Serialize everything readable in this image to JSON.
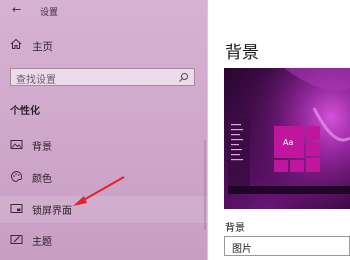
{
  "window": {
    "title": "设置",
    "back_glyph": "←"
  },
  "sidebar": {
    "home_label": "主页",
    "search_placeholder": "查找设置",
    "section_label": "个性化",
    "items": [
      {
        "label": "背景",
        "icon": "picture-icon"
      },
      {
        "label": "颜色",
        "icon": "palette-icon"
      },
      {
        "label": "锁屏界面",
        "icon": "lock-screen-icon"
      },
      {
        "label": "主题",
        "icon": "theme-icon"
      }
    ]
  },
  "main": {
    "title": "背景",
    "background_field_label": "背景",
    "background_value": "图片",
    "preview_tile_text": "Aa"
  },
  "colors": {
    "sidebar_tint": "#d1a9cc",
    "annotation_arrow": "#e8212b",
    "accent_tile": "#c0169e"
  }
}
